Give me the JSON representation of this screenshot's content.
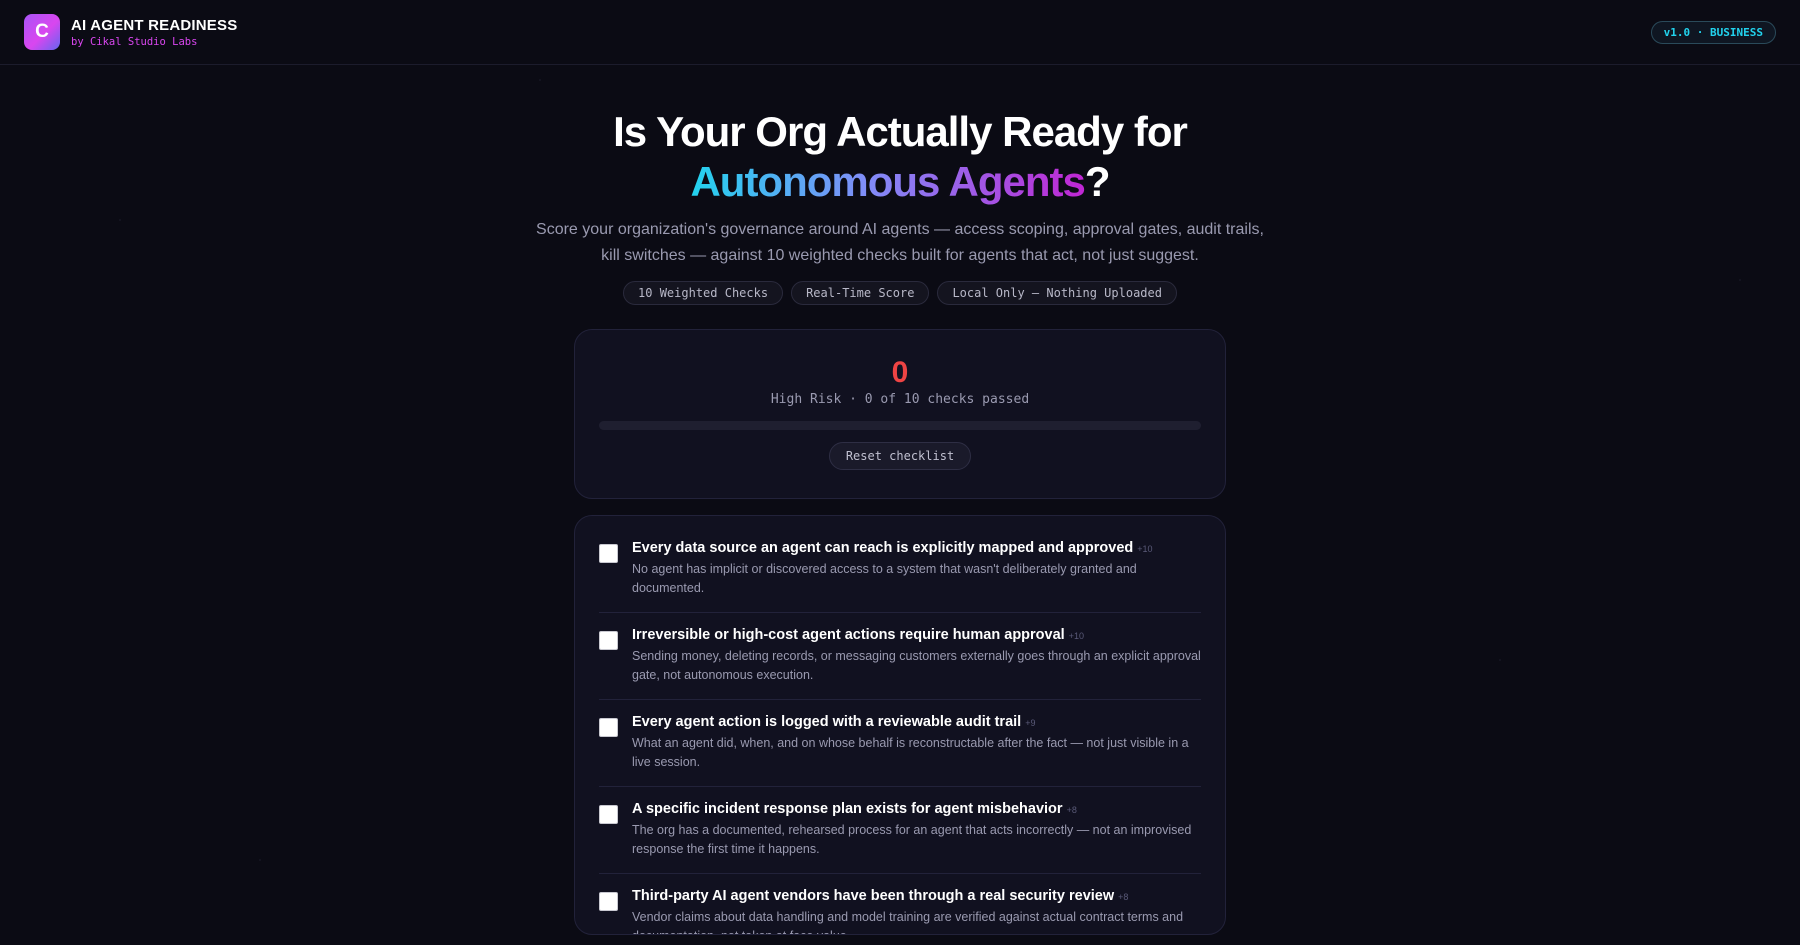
{
  "header": {
    "logo_letter": "C",
    "title": "AI AGENT READINESS",
    "subtitle": "by Cikal Studio Labs",
    "version": "v1.0 · BUSINESS"
  },
  "hero": {
    "title_line1": "Is Your Org Actually Ready for",
    "title_highlight": "Autonomous Agents",
    "title_suffix": "?",
    "lede": "Score your organization's governance around AI agents — access scoping, approval gates, audit trails, kill switches — against 10 weighted checks built for agents that act, not just suggest.",
    "chips": [
      "10 Weighted Checks",
      "Real-Time Score",
      "Local Only — Nothing Uploaded"
    ]
  },
  "score": {
    "value": "0",
    "status": "High Risk · 0 of 10 checks passed",
    "progress_fraction": 0,
    "reset_label": "Reset checklist",
    "risk_color": "#ef4444"
  },
  "checks": [
    {
      "title": "Every data source an agent can reach is explicitly mapped and approved",
      "weight": "+10",
      "desc": "No agent has implicit or discovered access to a system that wasn't deliberately granted and documented.",
      "checked": false
    },
    {
      "title": "Irreversible or high-cost agent actions require human approval",
      "weight": "+10",
      "desc": "Sending money, deleting records, or messaging customers externally goes through an explicit approval gate, not autonomous execution.",
      "checked": false
    },
    {
      "title": "Every agent action is logged with a reviewable audit trail",
      "weight": "+9",
      "desc": "What an agent did, when, and on whose behalf is reconstructable after the fact — not just visible in a live session.",
      "checked": false
    },
    {
      "title": "A specific incident response plan exists for agent misbehavior",
      "weight": "+8",
      "desc": "The org has a documented, rehearsed process for an agent that acts incorrectly — not an improvised response the first time it happens.",
      "checked": false
    },
    {
      "title": "Third-party AI agent vendors have been through a real security review",
      "weight": "+8",
      "desc": "Vendor claims about data handling and model training are verified against actual contract terms and documentation, not taken at face value.",
      "checked": false
    }
  ]
}
